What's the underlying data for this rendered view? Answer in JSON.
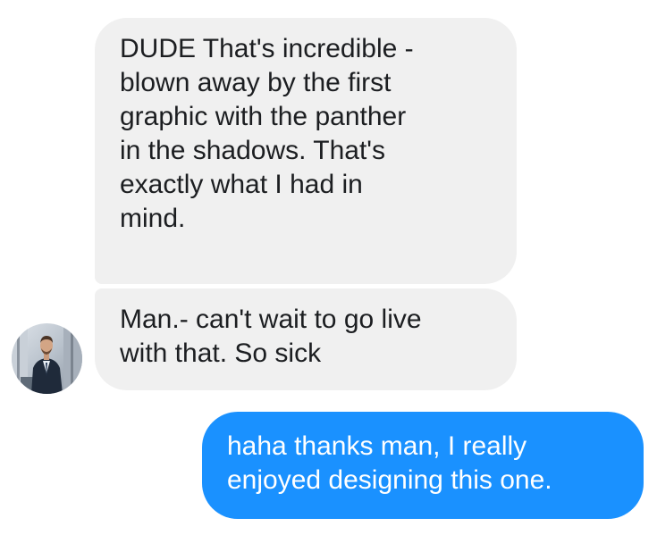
{
  "conversation": {
    "messages": [
      {
        "sender": "contact",
        "text": "DUDE That's incredible -\nblown away by the first\ngraphic with the panther\nin the shadows. That's\nexactly what I had in\nmind."
      },
      {
        "sender": "contact",
        "text": "Man.- can't wait to go live\nwith that. So sick"
      },
      {
        "sender": "me",
        "text": "haha thanks man, I really\nenjoyed designing this one."
      }
    ]
  },
  "colors": {
    "incoming_bubble": "#f0f0f0",
    "incoming_text": "#1c1e21",
    "outgoing_bubble": "#1a91ff",
    "outgoing_text": "#ffffff"
  },
  "icons": {
    "avatar": "contact-avatar-photo"
  }
}
